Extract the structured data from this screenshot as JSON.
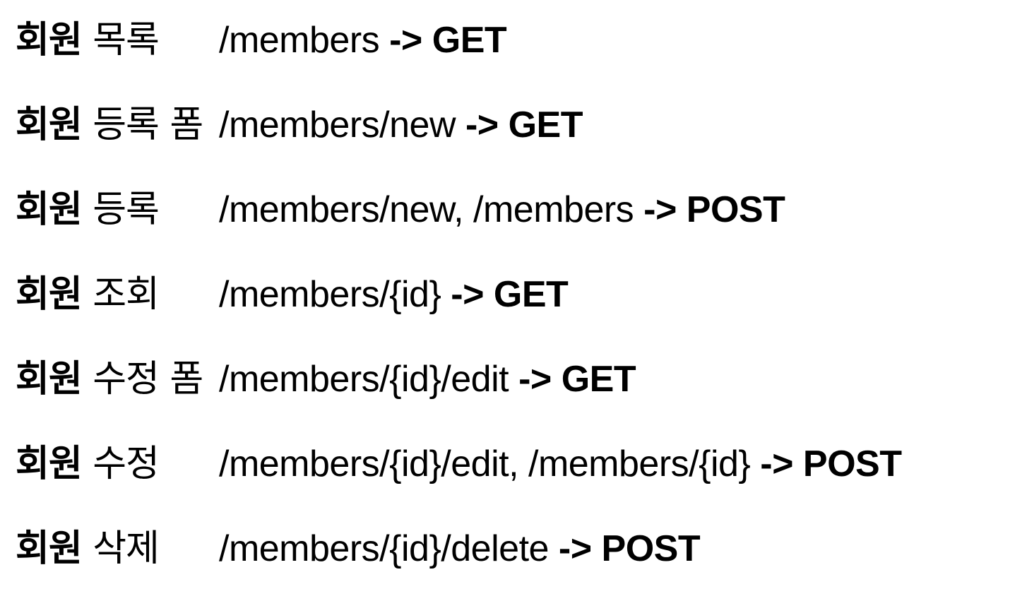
{
  "routes": [
    {
      "entity": "회원",
      "action": "목록",
      "path": "/members",
      "arrow": "->",
      "method": "GET"
    },
    {
      "entity": "회원",
      "action": "등록 폼",
      "path": "/members/new",
      "arrow": "->",
      "method": "GET"
    },
    {
      "entity": "회원",
      "action": "등록",
      "path": "/members/new, /members",
      "arrow": "->",
      "method": "POST"
    },
    {
      "entity": "회원",
      "action": "조회",
      "path": "/members/{id}",
      "arrow": "->",
      "method": "GET"
    },
    {
      "entity": "회원",
      "action": "수정 폼",
      "path": "/members/{id}/edit",
      "arrow": "->",
      "method": "GET"
    },
    {
      "entity": "회원",
      "action": "수정",
      "path": "/members/{id}/edit, /members/{id}",
      "arrow": "->",
      "method": "POST"
    },
    {
      "entity": "회원",
      "action": "삭제",
      "path": "/members/{id}/delete",
      "arrow": "->",
      "method": "POST"
    }
  ]
}
